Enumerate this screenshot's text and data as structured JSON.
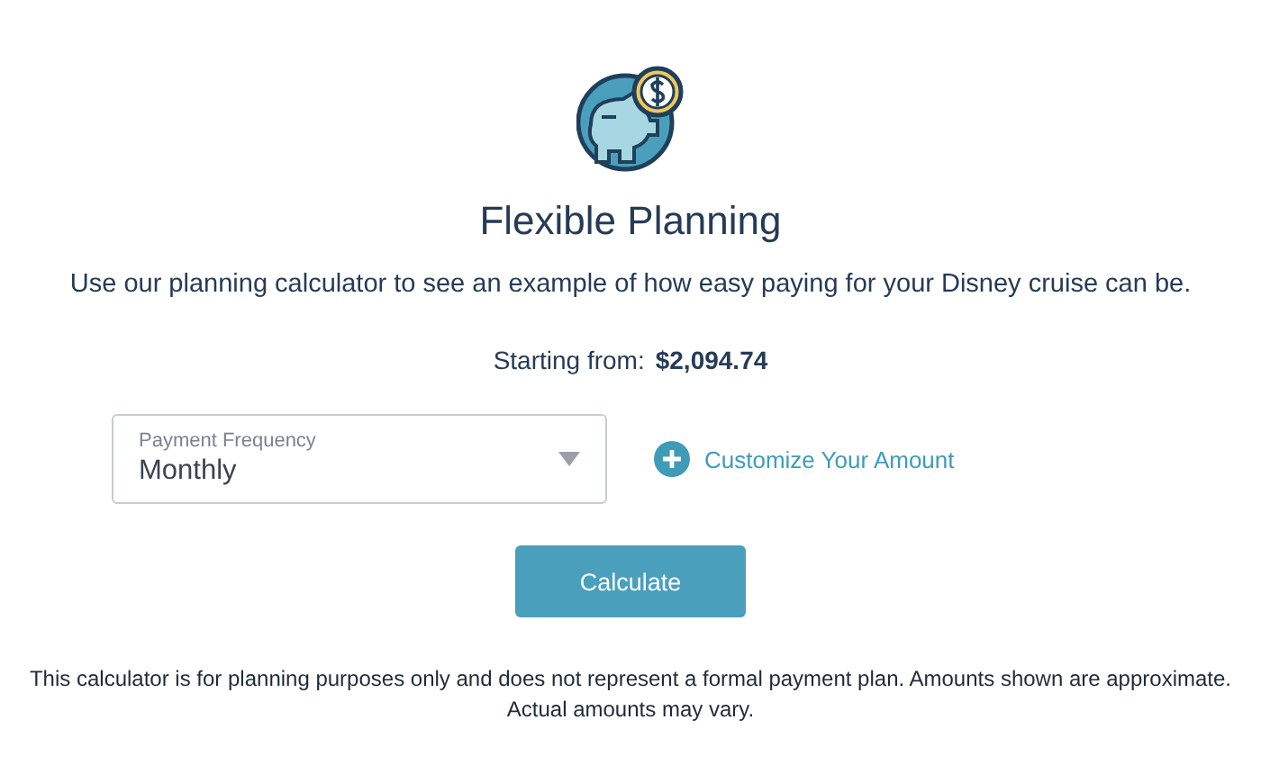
{
  "title": "Flexible Planning",
  "description": "Use our planning calculator to see an example of how easy paying for your Disney cruise can be.",
  "starting_from": {
    "label": "Starting from:",
    "amount": "$2,094.74"
  },
  "payment_frequency": {
    "label": "Payment Frequency",
    "value": "Monthly"
  },
  "customize_link": "Customize Your Amount",
  "calculate_button": "Calculate",
  "disclaimer": "This calculator is for planning purposes only and does not represent a formal payment plan. Amounts shown are approximate. Actual amounts may vary."
}
